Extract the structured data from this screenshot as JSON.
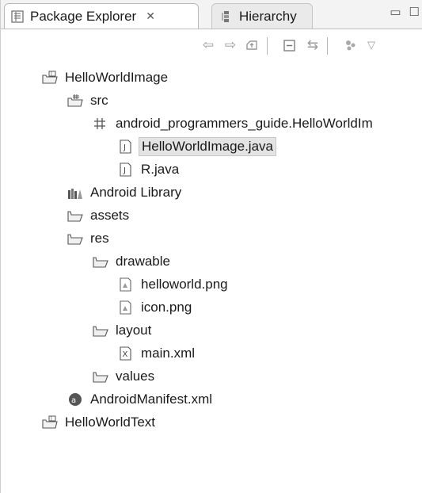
{
  "tabs": [
    {
      "label": "Package Explorer",
      "icon": "package-explorer-icon",
      "active": true,
      "close": "✕"
    },
    {
      "label": "Hierarchy",
      "icon": "hierarchy-icon",
      "active": false
    }
  ],
  "toolbar_icons": [
    "back-icon",
    "forward-icon",
    "up-icon",
    "collapse-all-icon",
    "link-with-editor-icon",
    "filter-icon",
    "view-menu-icon"
  ],
  "tree": [
    {
      "label": "HelloWorldImage",
      "icon": "project-icon",
      "level": 0
    },
    {
      "label": "src",
      "icon": "source-folder-icon",
      "level": 1
    },
    {
      "label": "android_programmers_guide.HelloWorldIm",
      "icon": "package-icon",
      "level": 2
    },
    {
      "label": "HelloWorldImage.java",
      "icon": "java-file-icon",
      "level": 3,
      "selected": true
    },
    {
      "label": "R.java",
      "icon": "java-file-icon",
      "level": 3
    },
    {
      "label": "Android Library",
      "icon": "library-icon",
      "level": 1
    },
    {
      "label": "assets",
      "icon": "folder-icon",
      "level": 1
    },
    {
      "label": "res",
      "icon": "folder-icon",
      "level": 1
    },
    {
      "label": "drawable",
      "icon": "folder-icon",
      "level": 2
    },
    {
      "label": "helloworld.png",
      "icon": "image-file-icon",
      "level": 3
    },
    {
      "label": "icon.png",
      "icon": "image-file-icon",
      "level": 3
    },
    {
      "label": "layout",
      "icon": "folder-icon",
      "level": 2
    },
    {
      "label": "main.xml",
      "icon": "xml-file-icon",
      "level": 3
    },
    {
      "label": "values",
      "icon": "folder-icon",
      "level": 2
    },
    {
      "label": "AndroidManifest.xml",
      "icon": "manifest-icon",
      "level": 1
    },
    {
      "label": "HelloWorldText",
      "icon": "project-icon",
      "level": 0
    }
  ]
}
